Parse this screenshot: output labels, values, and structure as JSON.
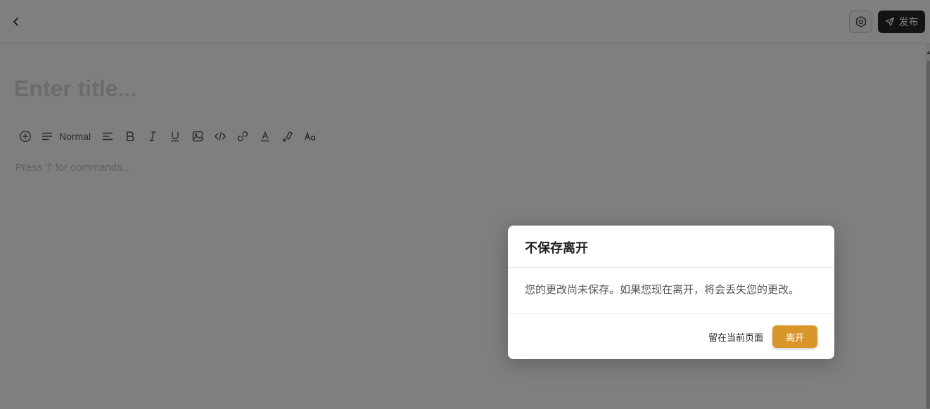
{
  "header": {
    "back_icon": "chevron-left-icon",
    "settings_icon": "hexagon-settings-icon",
    "publish_label": "发布",
    "publish_icon": "send-icon"
  },
  "editor": {
    "title_placeholder": "Enter title...",
    "command_hint": "Press '/' for commands..."
  },
  "toolbar": {
    "items": [
      {
        "icon": "plus-circle-icon"
      },
      {
        "icon": "paragraph-icon",
        "label": "Normal"
      },
      {
        "icon": "align-left-icon"
      },
      {
        "icon": "bold-icon"
      },
      {
        "icon": "italic-icon"
      },
      {
        "icon": "underline-icon"
      },
      {
        "icon": "image-icon"
      },
      {
        "icon": "code-icon"
      },
      {
        "icon": "link-icon"
      },
      {
        "icon": "text-color-icon"
      },
      {
        "icon": "highlight-icon"
      },
      {
        "icon": "font-size-icon"
      }
    ]
  },
  "dialog": {
    "title": "不保存离开",
    "message": "您的更改尚未保存。如果您现在离开，将会丢失您的更改。",
    "stay_label": "留在当前页面",
    "leave_label": "离开"
  },
  "colors": {
    "overlay": "rgba(0,0,0,0.5)",
    "leave_button": "#d9962a",
    "publish_button": "#262626"
  }
}
